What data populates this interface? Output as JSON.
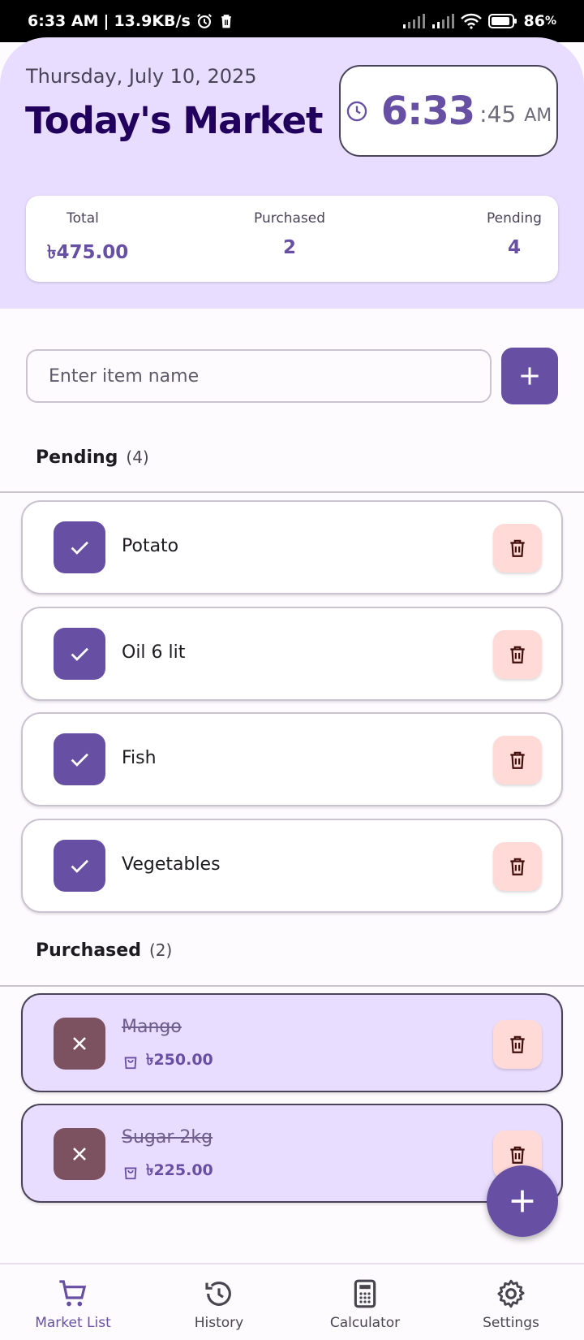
{
  "status_bar": {
    "time": "6:33 AM",
    "separator": "|",
    "net_speed": "13.9KB/s",
    "battery": "86"
  },
  "header": {
    "date": "Thursday, July 10, 2025",
    "title": "Today's Market",
    "clock": {
      "hm": "6:33",
      "sec": ":45",
      "ampm": "AM"
    }
  },
  "summary": {
    "total_label": "Total",
    "total_value": "৳475.00",
    "purchased_label": "Purchased",
    "purchased_value": "2",
    "pending_label": "Pending",
    "pending_value": "4"
  },
  "input": {
    "placeholder": "Enter item name"
  },
  "pending_section": {
    "label": "Pending",
    "count": "(4)",
    "items": [
      {
        "name": "Potato"
      },
      {
        "name": "Oil 6 lit"
      },
      {
        "name": "Fish"
      },
      {
        "name": "Vegetables"
      }
    ]
  },
  "purchased_section": {
    "label": "Purchased",
    "count": "(2)",
    "items": [
      {
        "name": "Mango",
        "price": "৳250.00"
      },
      {
        "name": "Sugar 2kg",
        "price": "৳225.00"
      }
    ]
  },
  "nav": {
    "items": [
      {
        "label": "Market List",
        "icon": "cart-icon",
        "active": true
      },
      {
        "label": "History",
        "icon": "history-icon",
        "active": false
      },
      {
        "label": "Calculator",
        "icon": "calculator-icon",
        "active": false
      },
      {
        "label": "Settings",
        "icon": "gear-icon",
        "active": false
      }
    ]
  },
  "colors": {
    "primary": "#6750a4",
    "header_bg": "#e9ddff",
    "delete_bg": "#ffdad6",
    "undo_bg": "#7d5260"
  }
}
